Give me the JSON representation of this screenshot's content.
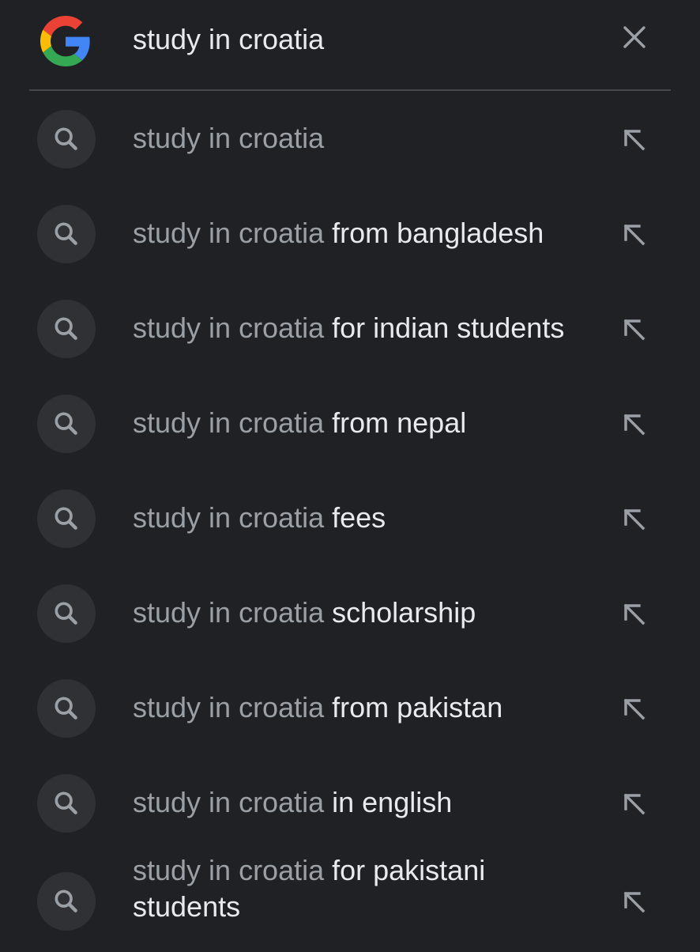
{
  "search": {
    "query": "study in croatia",
    "logo_icon": "google-g-icon",
    "clear_icon": "close-icon"
  },
  "colors": {
    "background": "#202124",
    "divider": "#45474a",
    "icon_circle": "#303134",
    "prefix_text": "#9aa0a6",
    "completion_text": "#e8eaed",
    "icon_gray": "#9aa0a6",
    "google_blue": "#4285F4",
    "google_red": "#EA4335",
    "google_yellow": "#FBBC05",
    "google_green": "#34A853"
  },
  "suggestions": [
    {
      "prefix": "study in croatia",
      "completion": "",
      "icon": "search-icon",
      "action_icon": "arrow-up-left-icon"
    },
    {
      "prefix": "study in croatia",
      "completion": " from bangladesh",
      "icon": "search-icon",
      "action_icon": "arrow-up-left-icon"
    },
    {
      "prefix": "study in croatia",
      "completion": " for indian students",
      "icon": "search-icon",
      "action_icon": "arrow-up-left-icon"
    },
    {
      "prefix": "study in croatia",
      "completion": " from nepal",
      "icon": "search-icon",
      "action_icon": "arrow-up-left-icon"
    },
    {
      "prefix": "study in croatia",
      "completion": " fees",
      "icon": "search-icon",
      "action_icon": "arrow-up-left-icon"
    },
    {
      "prefix": "study in croatia",
      "completion": " scholarship",
      "icon": "search-icon",
      "action_icon": "arrow-up-left-icon"
    },
    {
      "prefix": "study in croatia",
      "completion": " from pakistan",
      "icon": "search-icon",
      "action_icon": "arrow-up-left-icon"
    },
    {
      "prefix": "study in croatia",
      "completion": " in english",
      "icon": "search-icon",
      "action_icon": "arrow-up-left-icon"
    },
    {
      "prefix": "study in croatia",
      "completion": " for pakistani students",
      "icon": "search-icon",
      "action_icon": "arrow-up-left-icon"
    }
  ]
}
